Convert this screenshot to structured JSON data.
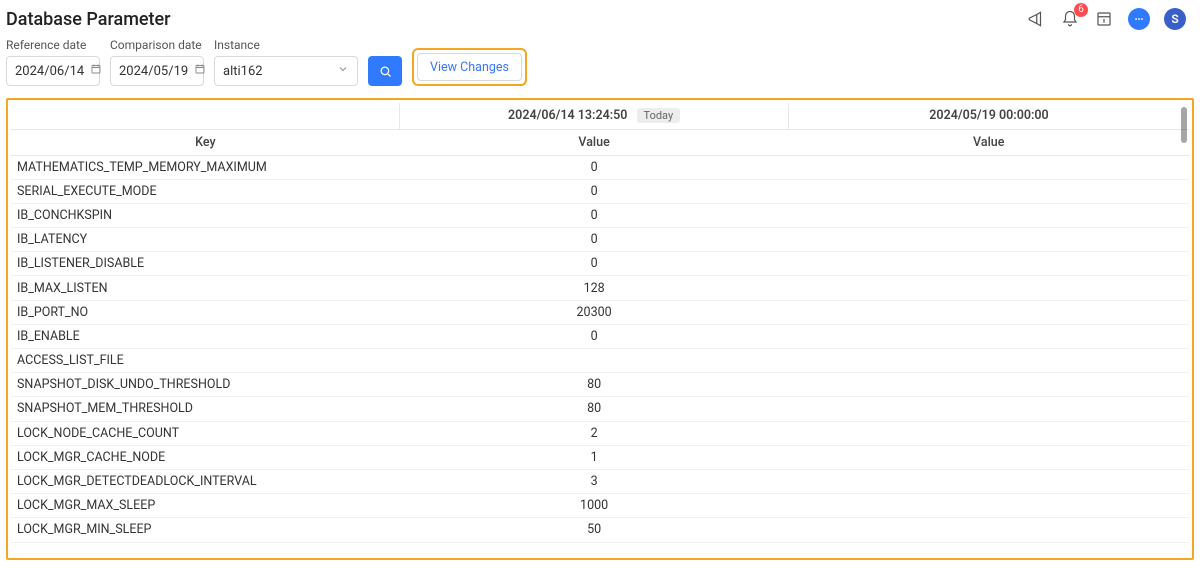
{
  "header": {
    "title": "Database Parameter",
    "notification_count": "6",
    "user_initial": "S"
  },
  "controls": {
    "reference_date": {
      "label": "Reference date",
      "value": "2024/06/14"
    },
    "comparison_date": {
      "label": "Comparison date",
      "value": "2024/05/19"
    },
    "instance": {
      "label": "Instance",
      "value": "alti162"
    },
    "view_changes_label": "View Changes"
  },
  "table": {
    "date_header_1": "2024/06/14 13:24:50",
    "today_label": "Today",
    "date_header_2": "2024/05/19 00:00:00",
    "col_key": "Key",
    "col_value": "Value",
    "rows": [
      {
        "key": "MATHEMATICS_TEMP_MEMORY_MAXIMUM",
        "v1": "0",
        "v2": ""
      },
      {
        "key": "SERIAL_EXECUTE_MODE",
        "v1": "0",
        "v2": ""
      },
      {
        "key": "IB_CONCHKSPIN",
        "v1": "0",
        "v2": ""
      },
      {
        "key": "IB_LATENCY",
        "v1": "0",
        "v2": ""
      },
      {
        "key": "IB_LISTENER_DISABLE",
        "v1": "0",
        "v2": ""
      },
      {
        "key": "IB_MAX_LISTEN",
        "v1": "128",
        "v2": ""
      },
      {
        "key": "IB_PORT_NO",
        "v1": "20300",
        "v2": ""
      },
      {
        "key": "IB_ENABLE",
        "v1": "0",
        "v2": ""
      },
      {
        "key": "ACCESS_LIST_FILE",
        "v1": "",
        "v2": ""
      },
      {
        "key": "SNAPSHOT_DISK_UNDO_THRESHOLD",
        "v1": "80",
        "v2": ""
      },
      {
        "key": "SNAPSHOT_MEM_THRESHOLD",
        "v1": "80",
        "v2": ""
      },
      {
        "key": "LOCK_NODE_CACHE_COUNT",
        "v1": "2",
        "v2": ""
      },
      {
        "key": "LOCK_MGR_CACHE_NODE",
        "v1": "1",
        "v2": ""
      },
      {
        "key": "LOCK_MGR_DETECTDEADLOCK_INTERVAL",
        "v1": "3",
        "v2": ""
      },
      {
        "key": "LOCK_MGR_MAX_SLEEP",
        "v1": "1000",
        "v2": ""
      },
      {
        "key": "LOCK_MGR_MIN_SLEEP",
        "v1": "50",
        "v2": ""
      }
    ]
  }
}
